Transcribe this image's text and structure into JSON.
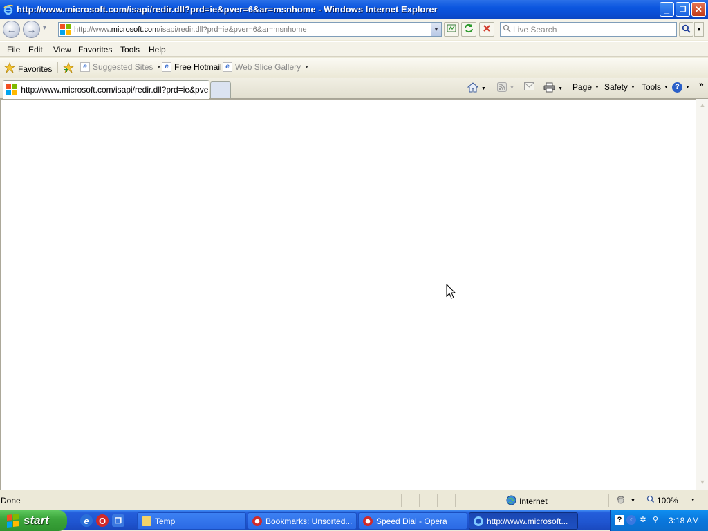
{
  "window": {
    "title": "http://www.microsoft.com/isapi/redir.dll?prd=ie&pver=6&ar=msnhome - Windows Internet Explorer",
    "minimize": "_",
    "restore": "❐",
    "close": "✕"
  },
  "navigation": {
    "back": "←",
    "forward": "→",
    "history_dropdown": "▾",
    "address_prefix": "http://www.",
    "address_domain": "microsoft.com",
    "address_suffix": "/isapi/redir.dll?prd=ie&pver=6&ar=msnhome",
    "address_dropdown": "▼",
    "compat_icon": "compatibility-view-icon",
    "refresh_icon": "refresh-icon",
    "stop_icon": "stop-icon",
    "search_placeholder": "Live Search",
    "search_icon": "magnifier-icon"
  },
  "menu": [
    "File",
    "Edit",
    "View",
    "Favorites",
    "Tools",
    "Help"
  ],
  "favorites_bar": {
    "favorites_label": "Favorites",
    "items": [
      {
        "label": "Suggested Sites",
        "has_dropdown": true,
        "dimmed": true
      },
      {
        "label": "Free Hotmail",
        "has_dropdown": false,
        "dimmed": false
      },
      {
        "label": "Web Slice Gallery",
        "has_dropdown": true,
        "dimmed": true
      }
    ]
  },
  "tabs": {
    "active_title": "http://www.microsoft.com/isapi/redir.dll?prd=ie&pver..."
  },
  "command_bar": {
    "page": "Page",
    "safety": "Safety",
    "tools": "Tools",
    "help": "?",
    "overflow": "»"
  },
  "status": {
    "text": "Done",
    "zone": "Internet",
    "zoom": "100%"
  },
  "taskbar": {
    "start_label": "start",
    "buttons": [
      {
        "label": "Temp",
        "icon": "folder-icon",
        "active": false
      },
      {
        "label": "Bookmarks: Unsorted...",
        "icon": "opera-icon",
        "active": false
      },
      {
        "label": "Speed Dial - Opera",
        "icon": "opera-icon",
        "active": false
      },
      {
        "label": "http://www.microsoft...",
        "icon": "ie-icon",
        "active": true
      }
    ],
    "clock": "3:18 AM"
  },
  "colors": {
    "titlebar": "#0b56df",
    "taskbar": "#245edb",
    "start": "#3ca63c",
    "tray": "#0a77dc",
    "ms_red": "#f25022",
    "ms_green": "#7fba00",
    "ms_blue": "#00a4ef",
    "ms_yellow": "#ffb900"
  }
}
